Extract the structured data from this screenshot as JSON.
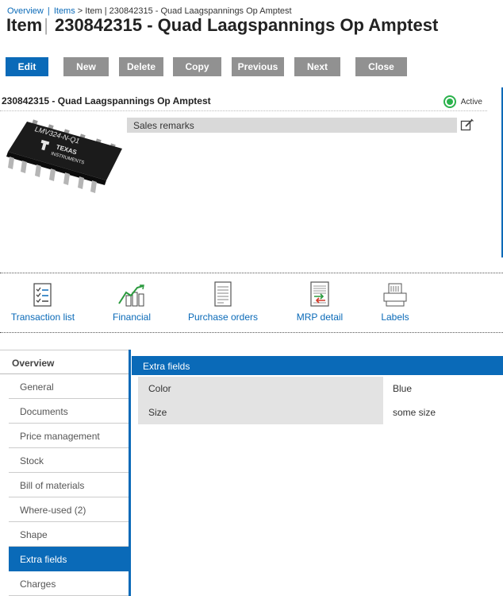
{
  "breadcrumb": {
    "overview": "Overview",
    "items": "Items",
    "sep": "|",
    "current": "> Item | 230842315 - Quad Laagspannings Op Amptest"
  },
  "title": {
    "prefix": "Item",
    "divider": "|",
    "name": "230842315 - Quad Laagspannings Op Amptest"
  },
  "toolbar": {
    "edit": "Edit",
    "new": "New",
    "delete": "Delete",
    "copy": "Copy",
    "previous": "Previous",
    "next": "Next",
    "close": "Close"
  },
  "item": {
    "name": "230842315 - Quad Laagspannings Op Amptest",
    "status": "Active",
    "status_color": "#2bb24c",
    "chip_text1": "LMV324-N-Q1",
    "chip_text2": "TEXAS",
    "chip_text3": "INSTRUMENTS"
  },
  "remarks": {
    "label": "Sales remarks"
  },
  "quick_links": [
    {
      "label": "Transaction list",
      "icon": "checklist-icon"
    },
    {
      "label": "Financial",
      "icon": "chart-icon"
    },
    {
      "label": "Purchase orders",
      "icon": "document-icon"
    },
    {
      "label": "MRP detail",
      "icon": "mrp-icon"
    },
    {
      "label": "Labels",
      "icon": "printer-icon"
    }
  ],
  "sidebar": {
    "header": "Overview",
    "items": [
      {
        "label": "General"
      },
      {
        "label": "Documents"
      },
      {
        "label": "Price management"
      },
      {
        "label": "Stock"
      },
      {
        "label": "Bill of materials"
      },
      {
        "label": "Where-used (2)"
      },
      {
        "label": "Shape"
      },
      {
        "label": "Extra fields"
      },
      {
        "label": "Charges"
      }
    ],
    "active": "Extra fields"
  },
  "extra_fields": {
    "title": "Extra fields",
    "rows": [
      {
        "label": "Color",
        "value": "Blue"
      },
      {
        "label": "Size",
        "value": "some size"
      }
    ]
  },
  "colors": {
    "accent": "#0a6ab8",
    "button_gray": "#919191"
  }
}
